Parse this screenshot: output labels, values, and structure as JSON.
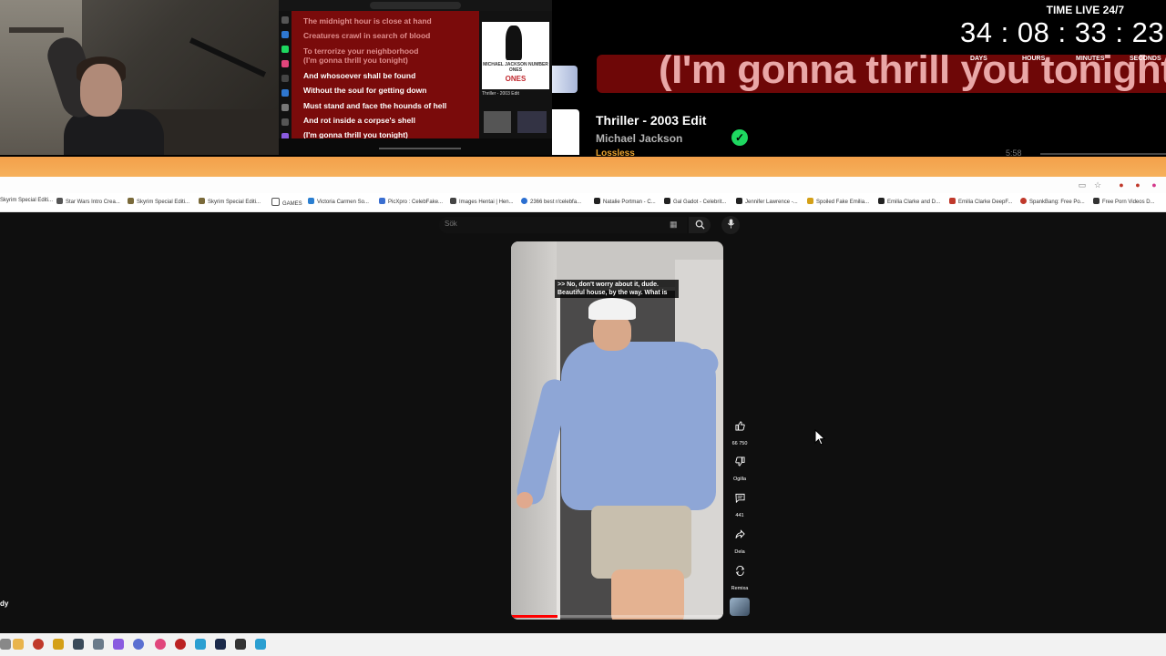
{
  "overlay": {
    "lyrics_past": [
      "The midnight hour is close at hand",
      "Creatures crawl in search of blood",
      "To terrorize your neighborhood",
      "(I'm gonna thrill you tonight)"
    ],
    "lyrics_current": [
      "And whosoever shall be found",
      "Without the soul for getting down",
      "Must stand and face the hounds of hell",
      "And rot inside a corpse's shell",
      "(I'm gonna thrill you tonight)"
    ],
    "big_lyric": "(I'm gonna thrill you tonight)",
    "now_playing": {
      "title": "Thriller - 2003 Edit",
      "artist": "Michael Jackson",
      "quality": "Lossless",
      "duration": "5:58",
      "album_title": "MICHAEL JACKSON NUMBER ONES",
      "album_word": "ONES",
      "mini_track": "Thriller - 2003 Edit"
    },
    "timer": {
      "title": "TIME LIVE 24/7",
      "days": "34",
      "hours": "08",
      "minutes": "33",
      "seconds": "23",
      "sep": ":",
      "labels": {
        "days": "DAYS",
        "hours": "HOURS",
        "minutes": "MINUTES",
        "seconds": "SECONDS"
      }
    }
  },
  "bookmarks": [
    "Skyrim Special Editi...",
    "Star Wars Intro Crea...",
    "Skyrim Special Editi...",
    "Skyrim Special Editi...",
    "GAMES",
    "Victoria Carmen So...",
    "PicXpro : CelebFake...",
    "Images Hentai | Hen...",
    "2366 best r/celebfa...",
    "Natalie Portman - C...",
    "Gal Gadot - Celebrit...",
    "Jennifer Lawrence -...",
    "Spoiled Fake Emilia...",
    "Emilia Clarke and D...",
    "Emilia Clarke DeepF...",
    "SpankBang: Free Po...",
    "Free Porn Videos D..."
  ],
  "search": {
    "placeholder": "Sök"
  },
  "video": {
    "caption": ">> No, don't worry about it, dude. Beautiful house, by the way. What is",
    "progress": 0.22
  },
  "actions": {
    "like_count": "66 750",
    "dislike_label": "Ogilla",
    "comments_count": "441",
    "share_label": "Dela",
    "remix_label": "Remixa"
  },
  "side_text": "dy",
  "colors": {
    "lyrics_bg": "#7a0b0b",
    "accent_orange": "#f3a04a",
    "spotify_green": "#1ed760",
    "progress_red": "#ff0000"
  },
  "icons": {
    "like": "thumbs-up-icon",
    "dislike": "thumbs-down-icon",
    "comment": "comment-icon",
    "share": "share-icon",
    "remix": "remix-icon",
    "search": "search-icon",
    "mic": "mic-icon",
    "keyboard": "keyboard-icon",
    "cursor": "cursor-icon",
    "check": "check-icon"
  }
}
